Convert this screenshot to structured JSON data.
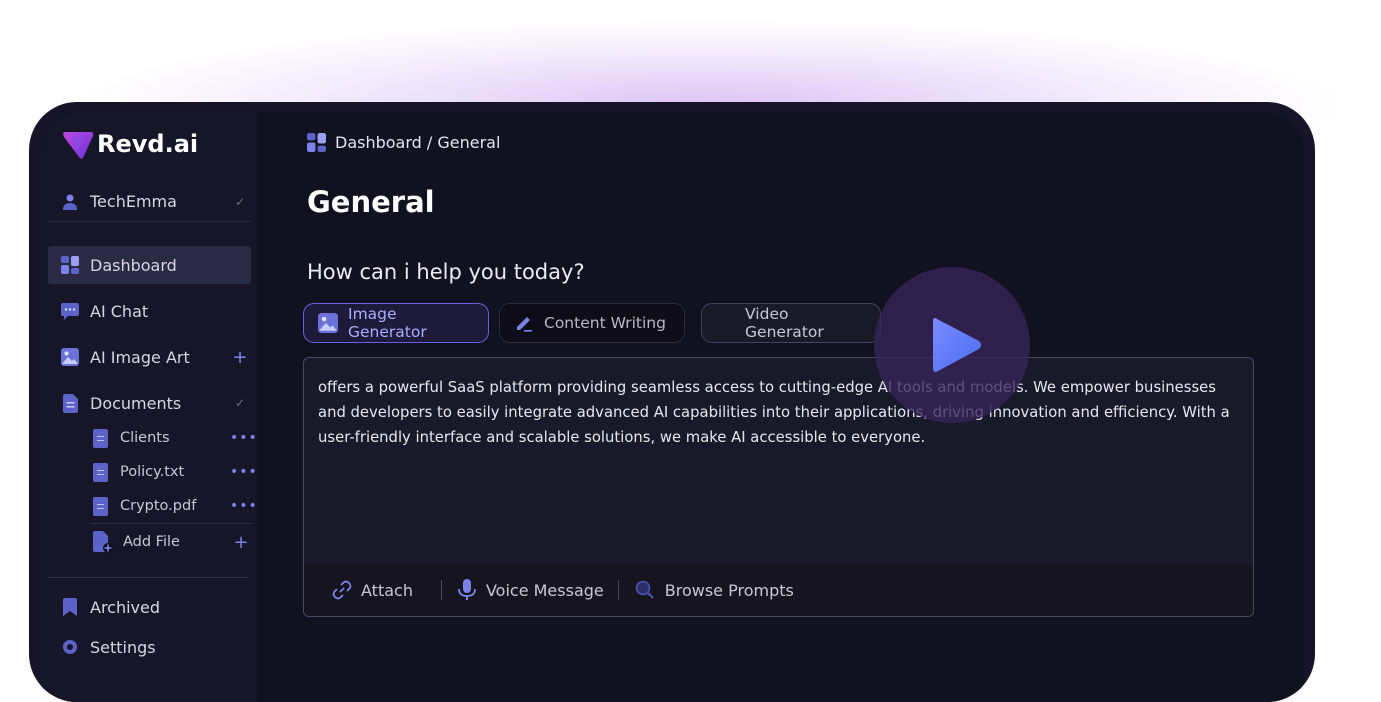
{
  "app": {
    "name": "Revd.ai"
  },
  "user": {
    "name": "TechEmma"
  },
  "sidebar": {
    "items": [
      {
        "label": "Dashboard",
        "icon": "dashboard-icon"
      },
      {
        "label": "AI Chat",
        "icon": "chat-icon"
      },
      {
        "label": "AI Image Art",
        "icon": "image-icon"
      },
      {
        "label": "Documents",
        "icon": "document-icon"
      }
    ],
    "documents": [
      {
        "label": "Clients"
      },
      {
        "label": "Policy.txt"
      },
      {
        "label": "Crypto.pdf"
      }
    ],
    "add_file": "Add File",
    "bottom": [
      {
        "label": "Archived",
        "icon": "bookmark-icon"
      },
      {
        "label": "Settings",
        "icon": "gear-icon"
      }
    ]
  },
  "breadcrumb": "Dashboard / General",
  "page": {
    "title": "General",
    "subtitle": "How can i help you today?"
  },
  "tabs": [
    {
      "label": "Image Generator",
      "active": true
    },
    {
      "label": "Content Writing",
      "active": false
    },
    {
      "label": "Video Generator",
      "active": false
    }
  ],
  "composer": {
    "text": "offers a powerful SaaS platform providing seamless access to cutting-edge  AI tools and models. We empower businesses and developers to easily integrate advanced AI capabilities into their applications, driving innovation  and efficiency. With a user-friendly interface and scalable solutions,  we make AI accessible to everyone.",
    "attach": "Attach",
    "voice": "Voice Message",
    "browse": "Browse Prompts"
  },
  "colors": {
    "accent": "#6b5fe6",
    "brand": "#a855f7",
    "background": "#12111f",
    "sidebar": "#171628"
  }
}
